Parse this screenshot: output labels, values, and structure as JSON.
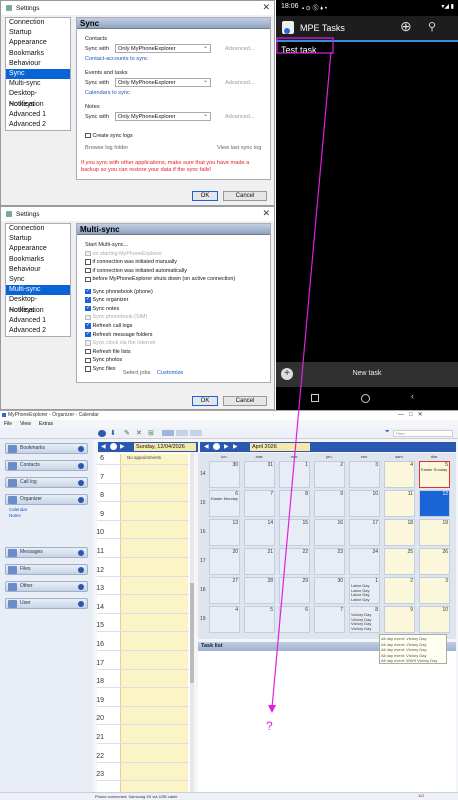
{
  "dialog1": {
    "title": "Settings",
    "nav": [
      "Connection",
      "Startup",
      "Appearance",
      "Bookmarks",
      "Behaviour",
      "Sync",
      "Multi-sync",
      "Desktop-Notification",
      "Hotkeys",
      "Advanced 1",
      "Advanced 2"
    ],
    "selected": "Sync",
    "panel_title": "Sync",
    "contacts": {
      "heading": "Contacts",
      "sync_with": "Sync with",
      "value": "Only MyPhoneExplorer",
      "advanced": "Advanced...",
      "link": "Contact-accounts to sync"
    },
    "events": {
      "heading": "Events and tasks",
      "sync_with": "Sync with",
      "value": "Only MyPhoneExplorer",
      "advanced": "Advanced...",
      "link": "Calendars to sync"
    },
    "notes": {
      "heading": "Notes",
      "sync_with": "Sync with",
      "value": "Only MyPhoneExplorer",
      "advanced": "Advanced..."
    },
    "create_logs": "Create sync logs",
    "browse_log": "Browse log folder",
    "view_log": "View last sync log",
    "warning": "If you sync with other applications, make sure that you have made a backup so you can restore your data if the sync fails!",
    "ok": "OK",
    "cancel": "Cancel"
  },
  "dialog2": {
    "title": "Settings",
    "nav": [
      "Connection",
      "Startup",
      "Appearance",
      "Bookmarks",
      "Behaviour",
      "Sync",
      "Multi-sync",
      "Desktop-Notification",
      "Hotkeys",
      "Advanced 1",
      "Advanced 2"
    ],
    "selected": "Multi-sync",
    "panel_title": "Multi-sync",
    "start_label": "Start Multi-sync...",
    "start_options": [
      {
        "label": "on starting MyPhoneExplorer",
        "checked": false,
        "disabled": true
      },
      {
        "label": "if connection was initiated manually",
        "checked": false,
        "disabled": false
      },
      {
        "label": "if connection was initiated automatically",
        "checked": false,
        "disabled": false
      },
      {
        "label": "before MyPhoneExplorer shuts down (on active connection)",
        "checked": false,
        "disabled": false
      }
    ],
    "sync_options": [
      {
        "label": "Sync phonebook (phone)",
        "checked": true,
        "disabled": false
      },
      {
        "label": "Sync organizer",
        "checked": true,
        "disabled": false
      },
      {
        "label": "Sync notes",
        "checked": true,
        "disabled": false
      },
      {
        "label": "Sync phonebook (SIM)",
        "checked": false,
        "disabled": true
      },
      {
        "label": "Refresh call logs",
        "checked": true,
        "disabled": false
      },
      {
        "label": "Refresh message folders",
        "checked": true,
        "disabled": false
      },
      {
        "label": "Sync clock via the Internet",
        "checked": false,
        "disabled": true
      },
      {
        "label": "Refresh file lists",
        "checked": false,
        "disabled": false
      },
      {
        "label": "Sync photos",
        "checked": false,
        "disabled": false
      },
      {
        "label": "Sync files",
        "checked": false,
        "disabled": false
      }
    ],
    "select_jobs": "Select jobs",
    "customize": "Customize",
    "ok": "OK",
    "cancel": "Cancel"
  },
  "phone": {
    "time": "18:06",
    "app_title": "MPE Tasks",
    "task": "Test task",
    "new_task": "New task"
  },
  "organizer": {
    "title": "MyPhoneExplorer - Organizer - Calendar",
    "menu": [
      "File",
      "View",
      "Extras"
    ],
    "sidebar": [
      {
        "label": "Bookmarks"
      },
      {
        "label": "Contacts"
      },
      {
        "label": "Call log"
      },
      {
        "label": "Organizer",
        "children": [
          "Calendar",
          "Notes"
        ]
      },
      {
        "label": "Messages"
      },
      {
        "label": "Files"
      },
      {
        "label": "Other"
      },
      {
        "label": "User"
      }
    ],
    "day_label": "Sunday, 12/04/2026",
    "month_label": "April 2026",
    "no_appointments": "No appointments",
    "hours": [
      "6",
      "7",
      "8",
      "9",
      "10",
      "11",
      "12",
      "13",
      "14",
      "15",
      "16",
      "17",
      "18",
      "19",
      "20",
      "21",
      "22",
      "23"
    ],
    "weekdays": [
      "lun.",
      "mar.",
      "mer.",
      "jeu.",
      "ven.",
      "sam.",
      "dim."
    ],
    "weeks": [
      {
        "num": "14",
        "days": [
          "30",
          "31",
          "1",
          "2",
          "3",
          "4",
          "5"
        ],
        "events": {
          "6": "Easter Sunday"
        }
      },
      {
        "num": "15",
        "days": [
          "6",
          "7",
          "8",
          "9",
          "10",
          "11",
          "12"
        ],
        "events": {
          "0": "Easter Monday"
        }
      },
      {
        "num": "16",
        "days": [
          "13",
          "14",
          "15",
          "16",
          "17",
          "18",
          "19"
        ],
        "events": {}
      },
      {
        "num": "17",
        "days": [
          "20",
          "21",
          "22",
          "23",
          "24",
          "25",
          "26"
        ],
        "events": {}
      },
      {
        "num": "18",
        "days": [
          "27",
          "28",
          "29",
          "30",
          "1",
          "2",
          "3"
        ],
        "events": {
          "4": "Labor Day\nLabor Day\nLabor Day\nLabor Day"
        }
      },
      {
        "num": "19",
        "days": [
          "4",
          "5",
          "6",
          "7",
          "8",
          "9",
          "10"
        ],
        "events": {
          "4": "Victory Day\nVictory Day\nVictory Day\nVictory Day"
        }
      }
    ],
    "task_list": "Task list",
    "tooltip": [
      "All day event: Victory Day",
      "All day event: Victory Day",
      "All day event: Victory Day",
      "All day event: Victory Day",
      "All day event: WWII Victory Day"
    ],
    "filter": "Filter",
    "status": "Phone connected: Samsung S9 via USB cable",
    "status_right": "112"
  },
  "annotation": {
    "mark": "?",
    "color": "#e020e0"
  }
}
